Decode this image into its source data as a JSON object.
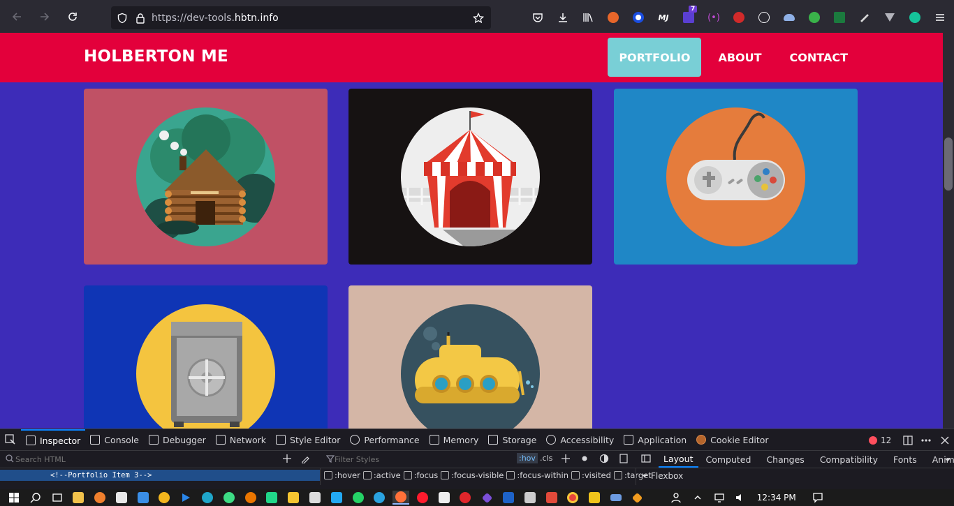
{
  "browser": {
    "url_prefix": "https://dev-tools.",
    "url_host": "hbtn.info",
    "extension_badge": "7"
  },
  "site": {
    "brand": "HOLBERTON ME",
    "nav": [
      {
        "label": "PORTFOLIO",
        "active": true
      },
      {
        "label": "ABOUT",
        "active": false
      },
      {
        "label": "CONTACT",
        "active": false
      }
    ],
    "portfolio_items": [
      {
        "name": "log-cabin",
        "bg": "#c05165",
        "circle": "#3aa58f"
      },
      {
        "name": "circus-tent",
        "bg": "#161212",
        "circle": "#eeeeee"
      },
      {
        "name": "game-controller",
        "bg": "#1f87c6",
        "circle": "#e57c3c"
      },
      {
        "name": "safe",
        "bg": "#0f35b5",
        "circle": "#f4c43f"
      },
      {
        "name": "submarine",
        "bg": "#d4b6a6",
        "circle": "#36515f"
      }
    ]
  },
  "devtools": {
    "tabs": [
      "Inspector",
      "Console",
      "Debugger",
      "Network",
      "Style Editor",
      "Performance",
      "Memory",
      "Storage",
      "Accessibility",
      "Application",
      "Cookie Editor"
    ],
    "error_count": "12",
    "search_html_placeholder": "Search HTML",
    "filter_styles_placeholder": "Filter Styles",
    "hov_label": ":hov",
    "cls_label": ".cls",
    "right_tabs": [
      "Layout",
      "Computed",
      "Changes",
      "Compatibility",
      "Fonts",
      "Animatio"
    ],
    "html_line": "<!--Portfolio Item 3-->",
    "pseudo_classes": [
      ":hover",
      ":active",
      ":focus",
      ":focus-visible",
      ":focus-within",
      ":visited",
      ":target"
    ],
    "flexbox_label": "Flexbox"
  },
  "taskbar": {
    "time": "12:34 PM"
  }
}
